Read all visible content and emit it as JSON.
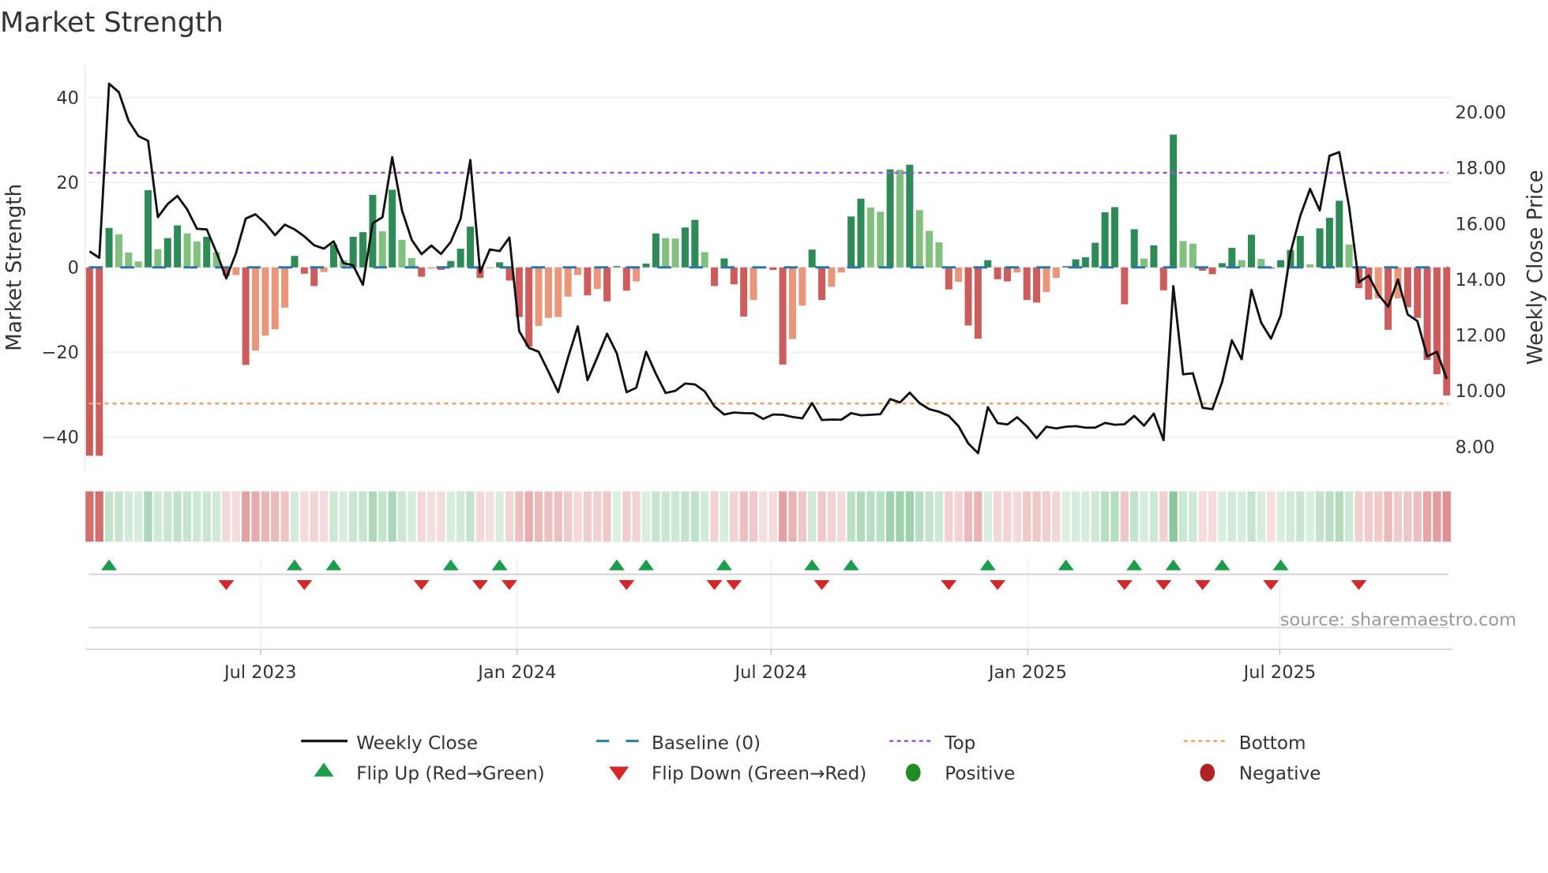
{
  "chart_data": {
    "type": "bar",
    "title": "Market Strength",
    "ylabel": "Market Strength",
    "y2label": "Weekly Close Price",
    "ylim": [
      -46,
      47
    ],
    "y2lim": [
      7.0,
      21.5
    ],
    "yticks": [
      40,
      20,
      0,
      -20,
      -40
    ],
    "ytick_labels": [
      "40",
      "20",
      "0",
      "−20",
      "−40"
    ],
    "y2ticks": [
      20,
      18,
      16,
      14,
      12,
      10,
      8
    ],
    "y2tick_labels": [
      "20.00",
      "18.00",
      "16.00",
      "14.00",
      "12.00",
      "10.00",
      "8.00"
    ],
    "xtick_labels": [
      "Jul 2023",
      "Jan 2024",
      "Jul 2024",
      "Jan 2025",
      "Jul 2025"
    ],
    "xtick_week_index": [
      17.5,
      43.8,
      69.8,
      96.1,
      121.9
    ],
    "top_level": 22.3,
    "bottom_level": -32.1,
    "baseline": 0,
    "source": "source: sharemaestro.com",
    "strength": [
      -44.4,
      -44.4,
      9.3,
      7.8,
      3.5,
      1.4,
      18.2,
      4.3,
      6.9,
      9.9,
      8.0,
      6.1,
      7.2,
      3.6,
      -2.0,
      -1.8,
      -23,
      -19.6,
      -16.1,
      -14.6,
      -9.5,
      2.7,
      -1.5,
      -4.4,
      -1.1,
      5.4,
      1.7,
      7.2,
      8.3,
      17.1,
      8.5,
      18.3,
      6.5,
      2.2,
      -2.2,
      -0.3,
      -0.6,
      1.5,
      4.4,
      9.6,
      -2.5,
      -0.2,
      1.2,
      -3.1,
      -11.7,
      -18.7,
      -13.8,
      -11.9,
      -11.7,
      -6.9,
      -1.8,
      -6.6,
      -5.1,
      -8.0,
      0.3,
      -5.5,
      -3.3,
      0.9,
      8.0,
      6.9,
      6.8,
      9.4,
      11.2,
      3.6,
      -4.4,
      2.1,
      -4.0,
      -11.6,
      -7.7,
      -0.2,
      -0.6,
      -22.9,
      -16.9,
      -9.0,
      4.2,
      -7.7,
      -4.6,
      -1.2,
      12.0,
      16.2,
      14.1,
      13.1,
      23.1,
      23.0,
      24.2,
      13.5,
      8.6,
      5.9,
      -5.2,
      -3.4,
      -13.7,
      -16.8,
      1.7,
      -2.8,
      -3.3,
      -1.2,
      -7.7,
      -8.3,
      -5.8,
      -2.5,
      0.3,
      1.9,
      2.4,
      5.8,
      13.0,
      14.2,
      -8.7,
      9.0,
      2.1,
      5.2,
      -5.4,
      31.3,
      6.2,
      5.6,
      -0.8,
      -1.6,
      1.0,
      4.6,
      1.7,
      7.7,
      2.0,
      -0.3,
      1.7,
      4.1,
      7.4,
      0.7,
      9.2,
      11.7,
      15.7,
      5.4,
      -4.9,
      -7.6,
      -7.3,
      -14.7,
      -7.3,
      -9.4,
      -11.9,
      -21.8,
      -25.2,
      -30.2
    ],
    "weekly_close": [
      14.98,
      14.75,
      21.0,
      20.69,
      19.66,
      19.12,
      18.95,
      16.21,
      16.68,
      16.97,
      16.49,
      15.79,
      15.77,
      14.94,
      14.01,
      14.92,
      16.16,
      16.31,
      15.99,
      15.56,
      15.94,
      15.77,
      15.52,
      15.2,
      15.08,
      15.34,
      14.56,
      14.48,
      13.78,
      15.99,
      16.21,
      18.36,
      16.45,
      15.39,
      14.88,
      15.19,
      14.89,
      15.32,
      16.15,
      18.26,
      14.23,
      15.05,
      14.99,
      15.48,
      12.12,
      11.52,
      11.38,
      10.67,
      9.93,
      11.16,
      12.29,
      10.36,
      11.18,
      12.03,
      11.32,
      9.93,
      10.09,
      11.38,
      10.59,
      9.9,
      9.98,
      10.24,
      10.21,
      9.96,
      9.42,
      9.13,
      9.2,
      9.18,
      9.17,
      8.97,
      9.13,
      9.12,
      9.04,
      8.99,
      9.54,
      8.93,
      8.95,
      8.94,
      9.18,
      9.1,
      9.12,
      9.14,
      9.68,
      9.56,
      9.91,
      9.54,
      9.32,
      9.23,
      9.08,
      8.71,
      8.09,
      7.74,
      9.39,
      8.82,
      8.77,
      9.03,
      8.71,
      8.28,
      8.69,
      8.63,
      8.69,
      8.71,
      8.66,
      8.66,
      8.83,
      8.76,
      8.78,
      9.08,
      8.73,
      9.16,
      8.21,
      13.73,
      10.57,
      10.61,
      9.37,
      9.32,
      10.29,
      11.79,
      11.11,
      13.6,
      12.42,
      11.85,
      12.69,
      14.94,
      16.26,
      17.22,
      16.45,
      18.41,
      18.54,
      16.59,
      13.87,
      14.11,
      13.43,
      13.0,
      13.97,
      12.72,
      12.48,
      11.21,
      11.38,
      10.41
    ],
    "flip_up_index": [
      2,
      21,
      25,
      37,
      42,
      54,
      57,
      65,
      74,
      78,
      92,
      100,
      107,
      111,
      116,
      122
    ],
    "flip_down_index": [
      14,
      22,
      34,
      40,
      43,
      55,
      64,
      66,
      75,
      88,
      93,
      106,
      110,
      114,
      121,
      130
    ],
    "legend_position": "bottom",
    "legend": [
      {
        "label": "Weekly Close",
        "kind": "line"
      },
      {
        "label": "Baseline (0)",
        "kind": "dash"
      },
      {
        "label": "Top",
        "kind": "dot-top"
      },
      {
        "label": "Bottom",
        "kind": "dot-bottom"
      },
      {
        "label": "Flip Up (Red→Green)",
        "kind": "tri-up"
      },
      {
        "label": "Flip Down (Green→Red)",
        "kind": "tri-down"
      },
      {
        "label": "Positive",
        "kind": "circle-pos"
      },
      {
        "label": "Negative",
        "kind": "circle-neg"
      }
    ],
    "grid": true
  },
  "colors": {
    "strong_green": "#2e8b57",
    "weak_green": "#81c07f",
    "strong_red": "#cd5c5c",
    "weak_red": "#e9967a",
    "baseline": "#2a77a8",
    "top": "#9b59d6",
    "bottom": "#f0a060",
    "flip_up": "#1a9e4a",
    "flip_down": "#d62728",
    "positive": "#228b22",
    "negative": "#b22222"
  }
}
